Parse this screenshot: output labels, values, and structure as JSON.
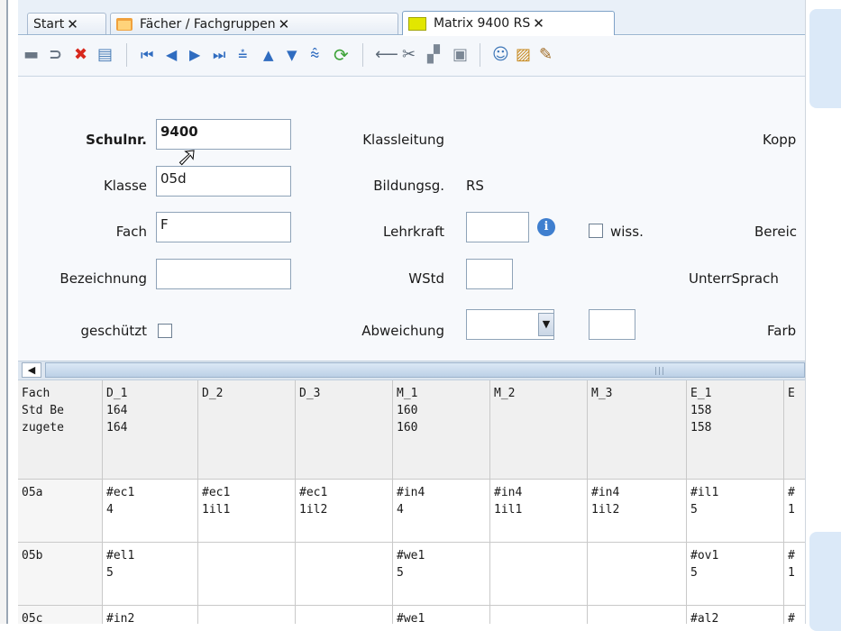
{
  "tabs": [
    {
      "label": "Start",
      "close": "✕"
    },
    {
      "label": "Fächer / Fachgruppen",
      "close": "✕"
    },
    {
      "label": "Matrix 9400 RS",
      "close": "✕"
    }
  ],
  "toolbar": {
    "icons": [
      "save-icon",
      "undo-icon",
      "delete-icon",
      "new-record-icon",
      "first-record-icon",
      "prev-record-icon",
      "next-record-icon",
      "last-record-icon",
      "move-top-icon",
      "move-up-icon",
      "move-down-icon",
      "move-bottom-icon",
      "refresh-icon",
      "back-arrow-icon",
      "cut-icon",
      "copy-icon",
      "paste-icon",
      "user-icon",
      "report-icon",
      "edit-icon"
    ],
    "glyphs": {
      "save": "▬",
      "undo": "⊃",
      "delete": "✖",
      "new": "▤",
      "first": "⏮",
      "prev": "◀",
      "next": "▶",
      "last": "⏭",
      "top": "⩮",
      "up": "▲",
      "down": "▼",
      "bottom": "⩯",
      "refresh": "⟳",
      "arrow": "⟵",
      "cut": "✂",
      "copy": "▞",
      "paste": "▣",
      "user": "☺",
      "report": "▨",
      "edit": "✎"
    }
  },
  "form": {
    "schulnr_label": "Schulnr.",
    "schulnr_value": "9400",
    "klasse_label": "Klasse",
    "klasse_value": "05d",
    "fach_label": "Fach",
    "fach_value": "F",
    "bezeichnung_label": "Bezeichnung",
    "bezeichnung_value": "",
    "geschuetzt_label": "geschützt",
    "klassleitung_label": "Klassleitung",
    "bildungsg_label": "Bildungsg.",
    "bildungsg_value": "RS",
    "lehrkraft_label": "Lehrkraft",
    "lehrkraft_value": "",
    "info_glyph": "i",
    "wiss_label": "wiss.",
    "wstd_label": "WStd",
    "wstd_value": "",
    "abweichung_label": "Abweichung",
    "abweichung_value": "",
    "dropdown_glyph": "▼",
    "kopp_label": "Kopp",
    "bereich_label": "Bereic",
    "unterrsprache_label": "UnterrSprach",
    "farb_label": "Farb"
  },
  "scrollbar": {
    "left_glyph": "◀",
    "grip": "|||"
  },
  "grid": {
    "corner": "Fach\nStd Be\nzugete",
    "columns": [
      {
        "name": "D_1",
        "std": "164",
        "zug": "164"
      },
      {
        "name": "D_2",
        "std": "",
        "zug": ""
      },
      {
        "name": "D_3",
        "std": "",
        "zug": ""
      },
      {
        "name": "M_1",
        "std": "160",
        "zug": "160"
      },
      {
        "name": "M_2",
        "std": "",
        "zug": ""
      },
      {
        "name": "M_3",
        "std": "",
        "zug": ""
      },
      {
        "name": "E_1",
        "std": "158",
        "zug": "158"
      },
      {
        "name": "E",
        "std": "",
        "zug": ""
      }
    ],
    "rows": [
      {
        "label": "05a",
        "cells": [
          "#ec1\n4",
          "#ec1\n1il1",
          "#ec1\n1il2",
          "#in4\n4",
          "#in4\n1il1",
          "#in4\n1il2",
          "#il1\n5",
          "#\n1"
        ]
      },
      {
        "label": "05b",
        "cells": [
          "#el1\n5",
          "",
          "",
          "#we1\n5",
          "",
          "",
          "#ov1\n5",
          "#\n1"
        ]
      },
      {
        "label": "05c",
        "cells": [
          "#in2",
          "",
          "",
          "#we1",
          "",
          "",
          "#al2",
          "#"
        ]
      }
    ]
  }
}
